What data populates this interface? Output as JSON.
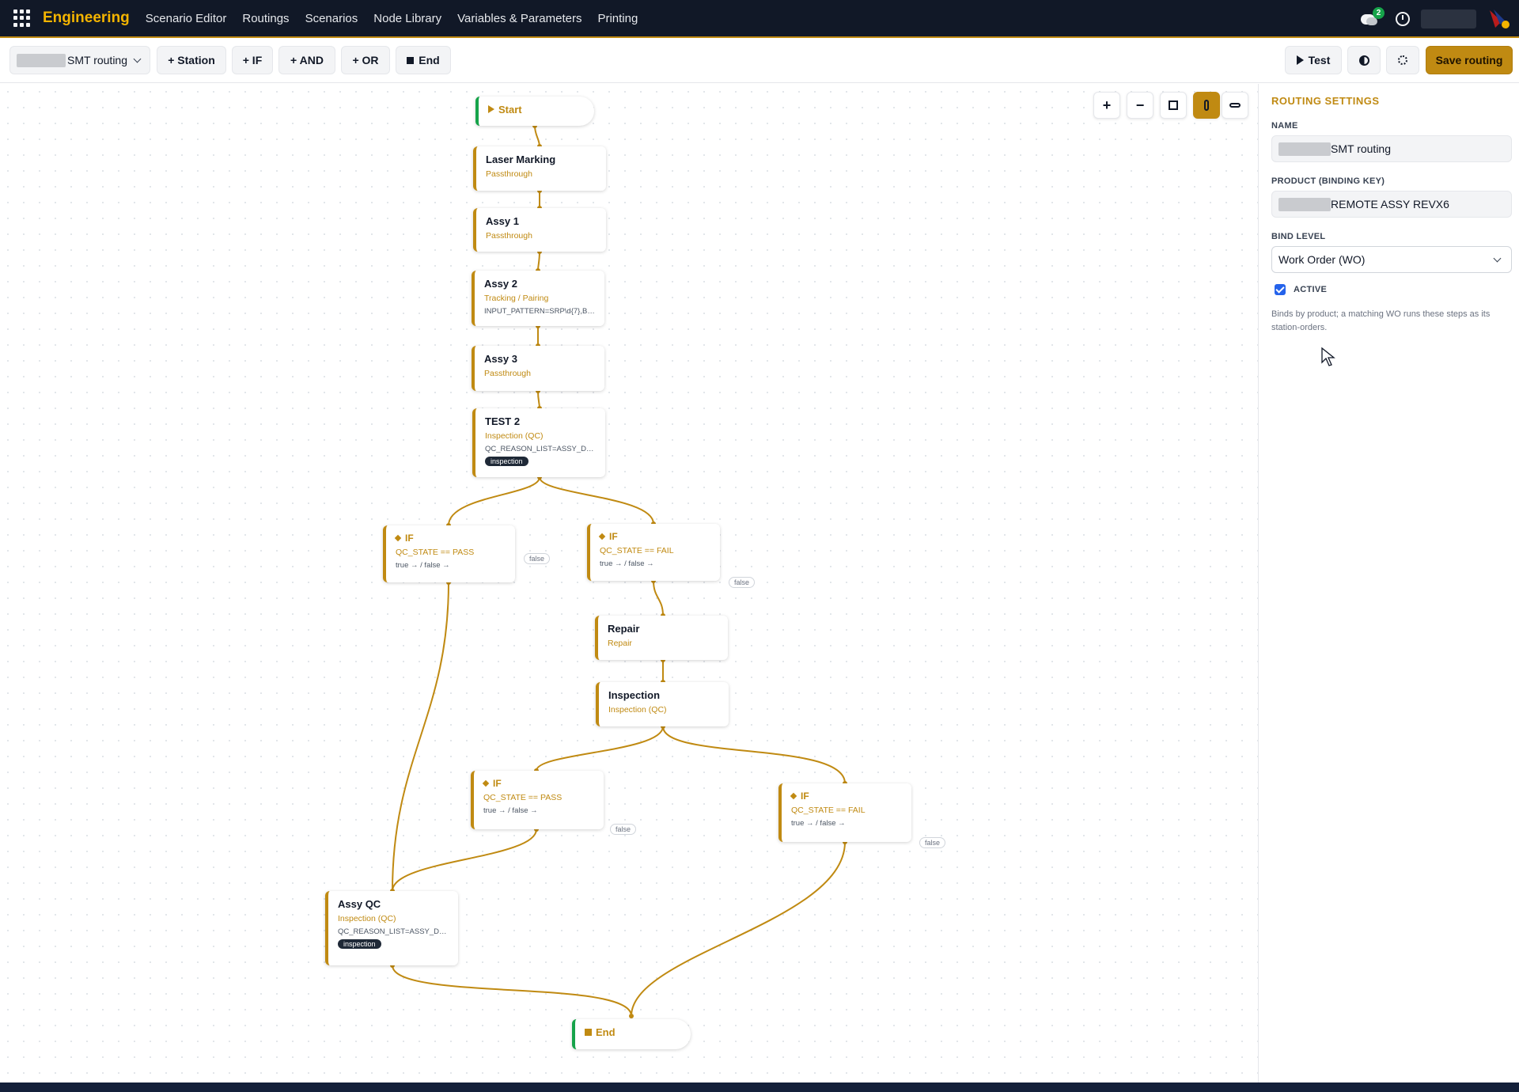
{
  "topbar": {
    "brand": "Engineering",
    "nav": [
      "Scenario Editor",
      "Routings",
      "Scenarios",
      "Node Library",
      "Variables & Parameters",
      "Printing"
    ],
    "chat_badge": "2"
  },
  "toolbar": {
    "routing_name": "SMT routing",
    "station": "+ Station",
    "if": "+ IF",
    "and": "+ AND",
    "or": "+ OR",
    "end": "End",
    "test": "Test",
    "save": "Save routing"
  },
  "canvas": {
    "controls": {
      "zoom_in": "+",
      "zoom_out": "−"
    },
    "nodes": {
      "start": {
        "title": "Start"
      },
      "laser": {
        "title": "Laser Marking",
        "type": "Passthrough"
      },
      "assy1": {
        "title": "Assy 1",
        "type": "Passthrough"
      },
      "assy2": {
        "title": "Assy 2",
        "type": "Tracking / Pairing",
        "param": "INPUT_PATTERN=SRP\\d{7},BOX_..."
      },
      "assy3": {
        "title": "Assy 3",
        "type": "Passthrough"
      },
      "test2": {
        "title": "TEST 2",
        "type": "Inspection (QC)",
        "param": "QC_REASON_LIST=ASSY_DEFEC...",
        "tag": "inspection"
      },
      "if_pass_1": {
        "title": "IF",
        "condition": "QC_STATE == PASS",
        "branches": "true → / false →",
        "false_label": "false"
      },
      "if_fail_1": {
        "title": "IF",
        "condition": "QC_STATE == FAIL",
        "branches": "true → / false →",
        "false_label": "false"
      },
      "repair": {
        "title": "Repair",
        "type": "Repair"
      },
      "inspection": {
        "title": "Inspection",
        "type": "Inspection (QC)"
      },
      "if_pass_2": {
        "title": "IF",
        "condition": "QC_STATE == PASS",
        "branches": "true → / false →",
        "false_label": "false"
      },
      "if_fail_2": {
        "title": "IF",
        "condition": "QC_STATE == FAIL",
        "branches": "true → / false →",
        "false_label": "false"
      },
      "assyqc": {
        "title": "Assy QC",
        "type": "Inspection (QC)",
        "param": "QC_REASON_LIST=ASSY_DEFEC...",
        "tag": "inspection"
      },
      "end": {
        "title": "End"
      }
    }
  },
  "panel": {
    "title": "ROUTING SETTINGS",
    "name_label": "NAME",
    "name_value": "SMT routing",
    "product_label": "PRODUCT (BINDING KEY)",
    "product_value": "REMOTE ASSY REVX6",
    "bind_label": "BIND LEVEL",
    "bind_value": "Work Order (WO)",
    "active_label": "ACTIVE",
    "active": true,
    "help_text": "Binds by product; a matching WO runs these steps as its station-orders."
  },
  "colors": {
    "accent": "#c08a12",
    "nav_bg": "#111827",
    "start_end": "#16a34a"
  }
}
